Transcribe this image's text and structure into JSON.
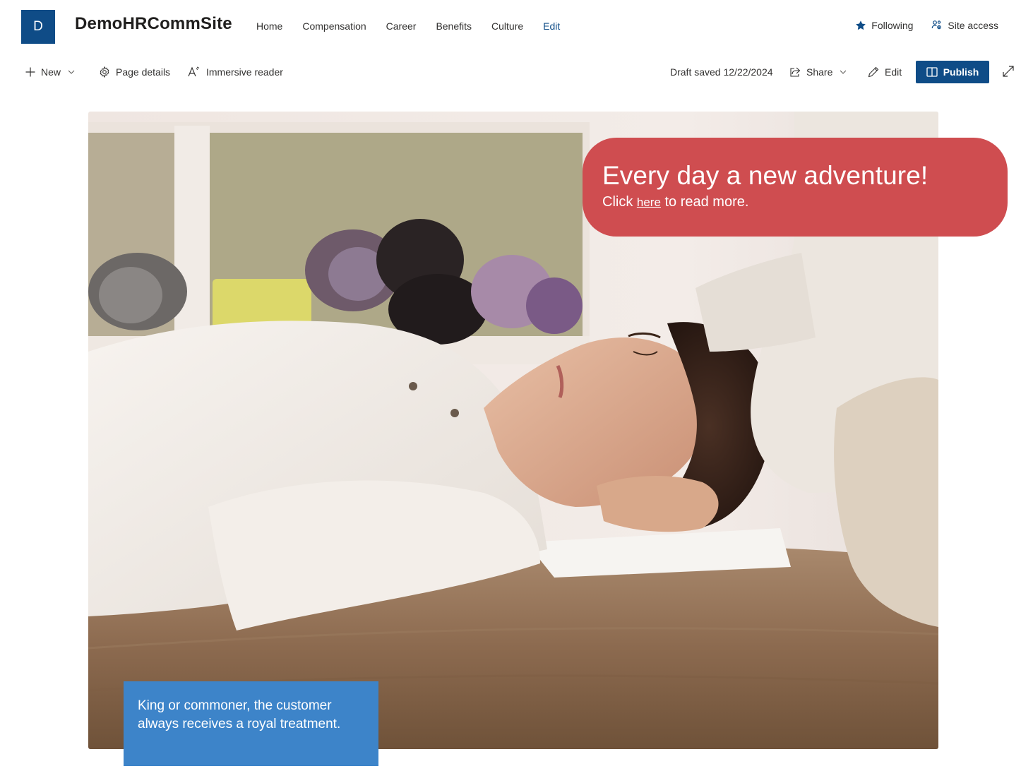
{
  "site": {
    "logo_letter": "D",
    "title": "DemoHRCommSite"
  },
  "nav": {
    "items": [
      "Home",
      "Compensation",
      "Career",
      "Benefits",
      "Culture"
    ],
    "edit_label": "Edit"
  },
  "header_actions": {
    "following_label": "Following",
    "site_access_label": "Site access"
  },
  "command_bar": {
    "new_label": "New",
    "page_details_label": "Page details",
    "immersive_reader_label": "Immersive reader",
    "draft_status": "Draft saved 12/22/2024",
    "share_label": "Share",
    "edit_label": "Edit",
    "publish_label": "Publish"
  },
  "hero": {
    "headline": "Every day a new adventure!",
    "subline_prefix": "Click ",
    "subline_link": "here",
    "subline_suffix": " to read more.",
    "quote": "King or commoner, the customer always receives a royal treatment."
  },
  "colors": {
    "brand": "#0f4c87",
    "callout": "#cf4d50",
    "quote_box": "#3d84c9"
  }
}
